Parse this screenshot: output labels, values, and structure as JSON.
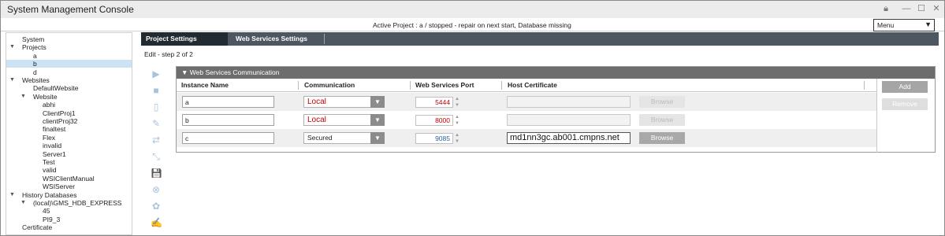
{
  "window": {
    "title": "System Management Console"
  },
  "status": {
    "text": "Active Project : a / stopped - repair on next start, Database missing",
    "menu_label": "Menu"
  },
  "tree": [
    {
      "label": "System",
      "depth": 0,
      "expand": ""
    },
    {
      "label": "Projects",
      "depth": 0,
      "expand": "▼"
    },
    {
      "label": "a",
      "depth": 1,
      "expand": ""
    },
    {
      "label": "b",
      "depth": 1,
      "expand": "",
      "selected": true
    },
    {
      "label": "d",
      "depth": 1,
      "expand": ""
    },
    {
      "label": "Websites",
      "depth": 0,
      "expand": "▼"
    },
    {
      "label": "DefaultWebsite",
      "depth": 1,
      "expand": ""
    },
    {
      "label": "Website",
      "depth": 1,
      "expand": "▼"
    },
    {
      "label": "abhi",
      "depth": 2,
      "expand": ""
    },
    {
      "label": "ClientProj1",
      "depth": 2,
      "expand": ""
    },
    {
      "label": "clientProj32",
      "depth": 2,
      "expand": ""
    },
    {
      "label": "finaltest",
      "depth": 2,
      "expand": ""
    },
    {
      "label": "Flex",
      "depth": 2,
      "expand": ""
    },
    {
      "label": "invalid",
      "depth": 2,
      "expand": ""
    },
    {
      "label": "Server1",
      "depth": 2,
      "expand": ""
    },
    {
      "label": "Test",
      "depth": 2,
      "expand": ""
    },
    {
      "label": "valid",
      "depth": 2,
      "expand": ""
    },
    {
      "label": "WSIClientManual",
      "depth": 2,
      "expand": ""
    },
    {
      "label": "WSIServer",
      "depth": 2,
      "expand": ""
    },
    {
      "label": "History Databases",
      "depth": 0,
      "expand": "▼"
    },
    {
      "label": "(local)\\GMS_HDB_EXPRESS",
      "depth": 1,
      "expand": "▼"
    },
    {
      "label": "45",
      "depth": 2,
      "expand": ""
    },
    {
      "label": "PI9_3",
      "depth": 2,
      "expand": ""
    },
    {
      "label": "Certificate",
      "depth": 0,
      "expand": ""
    }
  ],
  "tabs": [
    {
      "label": "Project Settings",
      "active": true
    },
    {
      "label": "Web Services Settings",
      "active": false
    }
  ],
  "step_text": "Edit - step 2 of 2",
  "toolbar": [
    "play-icon",
    "stop-icon",
    "page-icon",
    "pen-icon",
    "connect-icon",
    "resize-icon",
    "save-icon",
    "cancel-icon",
    "network-icon",
    "sign-icon"
  ],
  "panel": {
    "title": "▼ Web Services Communication",
    "columns": [
      "Instance Name",
      "Communication",
      "Web Services Port",
      "Host Certificate"
    ],
    "rows": [
      {
        "instance": "a",
        "communication": "Local",
        "comm_style": "red",
        "port": "5444",
        "port_style": "red",
        "certificate": "",
        "browse_enabled": false
      },
      {
        "instance": "b",
        "communication": "Local",
        "comm_style": "red",
        "port": "8000",
        "port_style": "red",
        "certificate": "",
        "browse_enabled": false
      },
      {
        "instance": "c",
        "communication": "Secured",
        "comm_style": "normal",
        "port": "9085",
        "port_style": "blue",
        "certificate": "md1nn3gc.ab001.cmpns.net",
        "browse_enabled": true
      }
    ],
    "browse_label": "Browse",
    "add_label": "Add",
    "remove_label": "Remove"
  },
  "colors": {
    "tab_bar": "#4e5761",
    "panel_header": "#6d6d6d",
    "selection": "#cde3f5",
    "error_text": "#c00000"
  }
}
